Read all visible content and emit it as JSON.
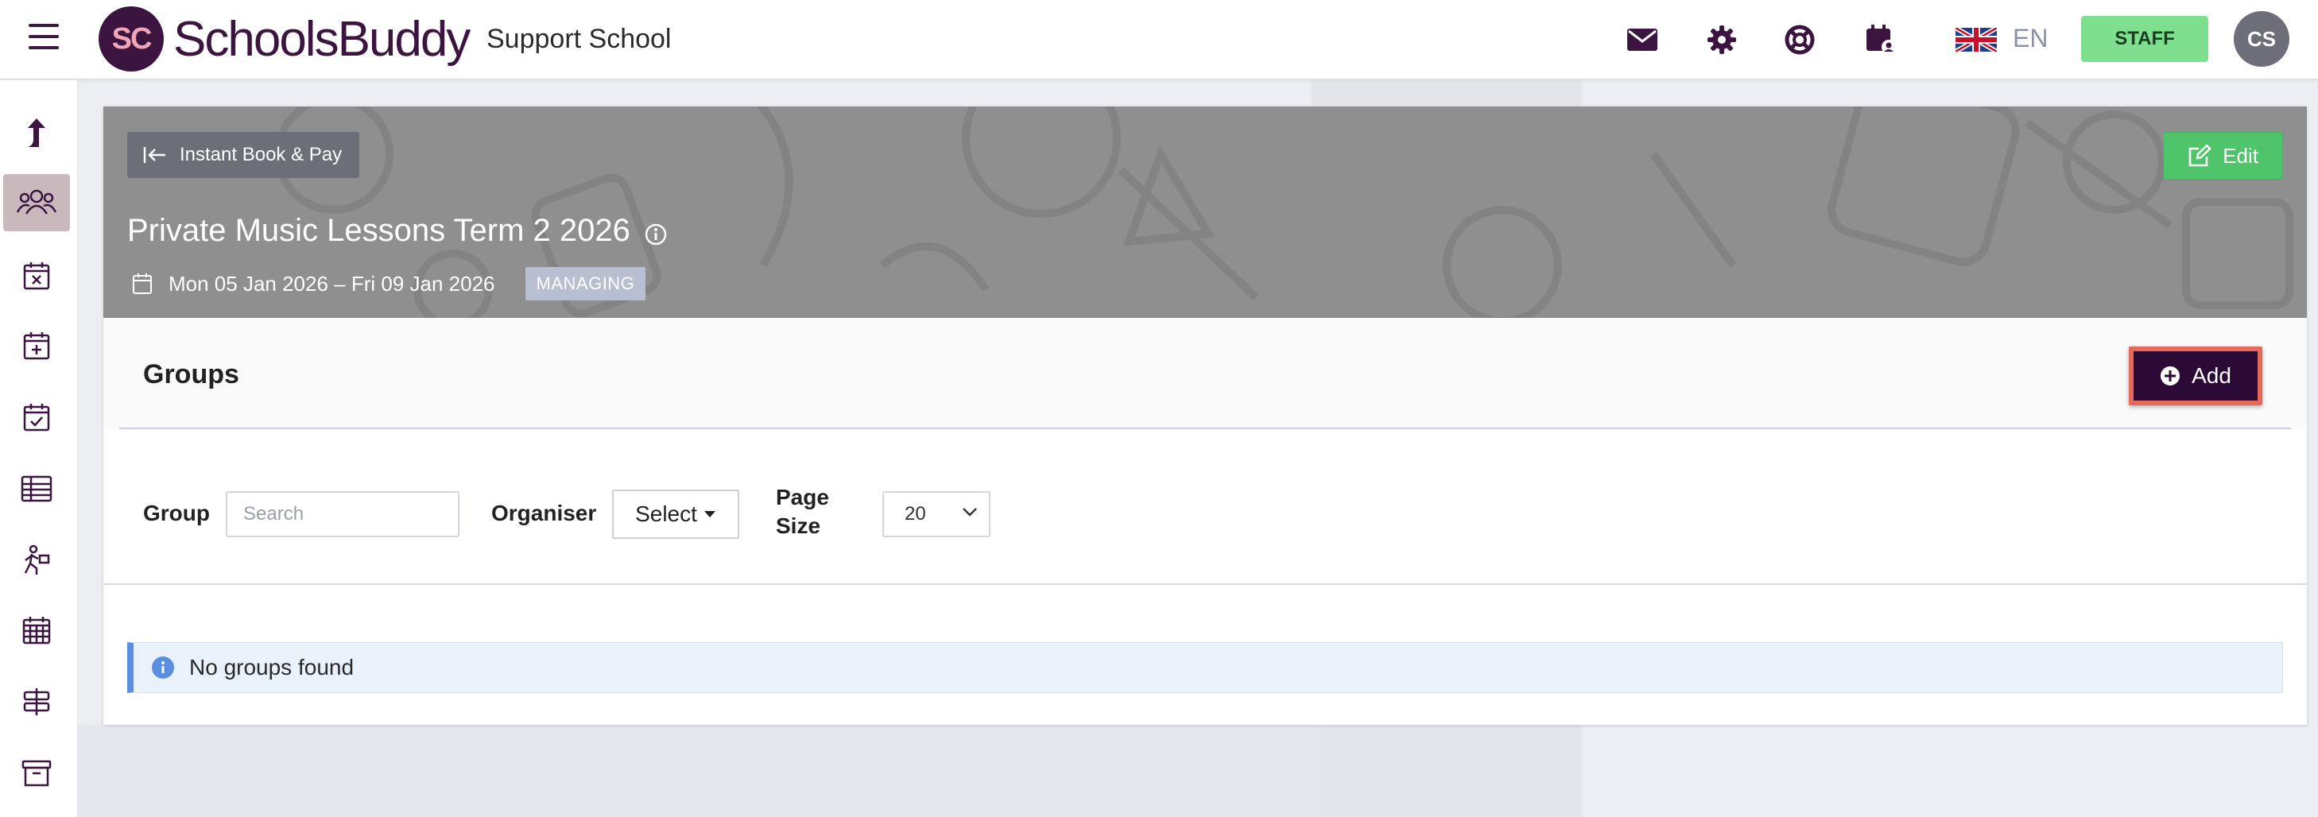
{
  "header": {
    "logo_text": "SC",
    "brand": "SchoolsBuddy",
    "school": "Support School",
    "language": "EN",
    "staff_label": "STAFF",
    "avatar_initials": "CS"
  },
  "banner": {
    "back_label": "Instant Book & Pay",
    "edit_label": "Edit",
    "title": "Private Music Lessons Term 2 2026",
    "date_range": "Mon 05 Jan 2026 – Fri 09 Jan 2026",
    "status_badge": "MANAGING"
  },
  "groups": {
    "title": "Groups",
    "add_label": "Add"
  },
  "filters": {
    "group_label": "Group",
    "search_placeholder": "Search",
    "organiser_label": "Organiser",
    "organiser_value": "Select",
    "page_size_label_1": "Page",
    "page_size_label_2": "Size",
    "page_size_value": "20"
  },
  "alert": {
    "message": "No groups found"
  },
  "colors": {
    "brand": "#3b1440",
    "staff": "#7ee08e",
    "edit": "#4fc46a",
    "add": "#2c0a36",
    "add_highlight": "#e56a5a",
    "alert_accent": "#5a8ee0"
  },
  "sidebar": {
    "items": [
      "upload-arrow-icon",
      "users-icon",
      "calendar-x-icon",
      "calendar-plus-icon",
      "calendar-check-icon",
      "table-icon",
      "running-person-icon",
      "calendar-grid-icon",
      "signpost-icon",
      "archive-icon"
    ],
    "active_index": 1
  }
}
